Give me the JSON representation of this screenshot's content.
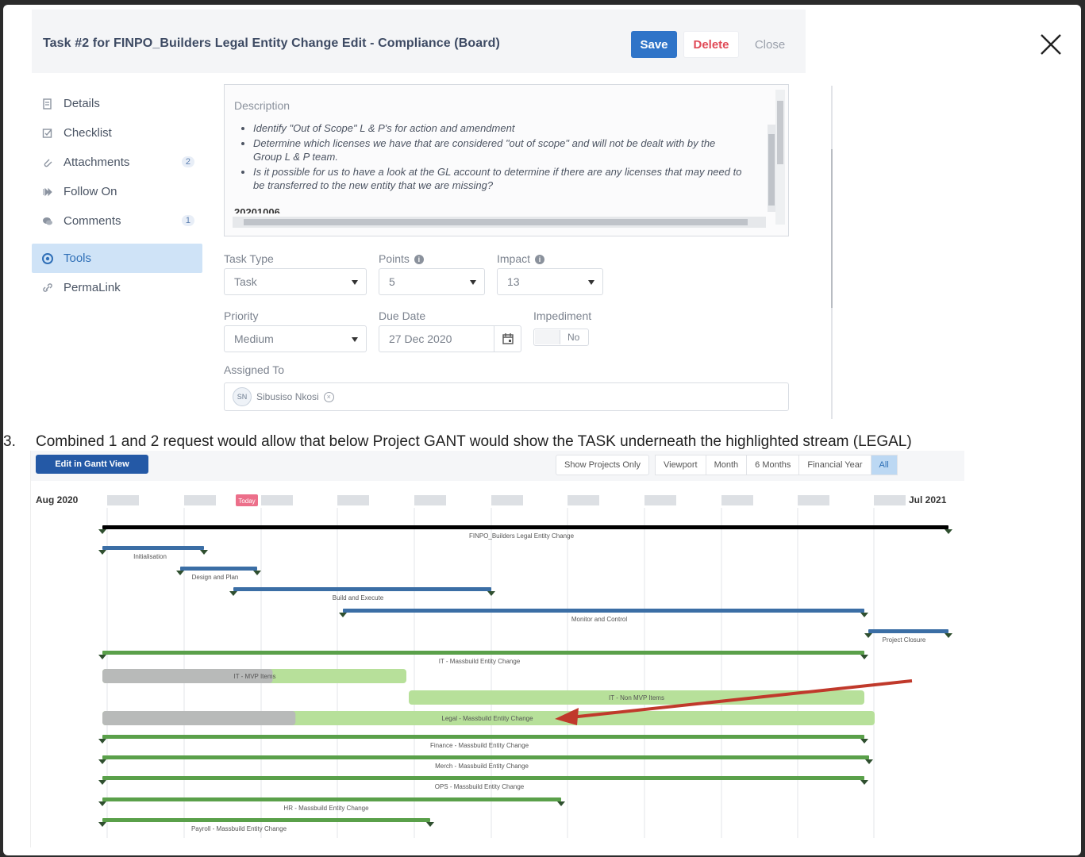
{
  "dialog": {
    "title": "Task #2 for FINPO_Builders Legal Entity Change Edit - Compliance (Board)",
    "save_label": "Save",
    "delete_label": "Delete",
    "close_label": "Close"
  },
  "sidebar": {
    "items": [
      {
        "label": "Details",
        "icon": "document-icon"
      },
      {
        "label": "Checklist",
        "icon": "checkbox-icon"
      },
      {
        "label": "Attachments",
        "icon": "paperclip-icon",
        "badge": "2"
      },
      {
        "label": "Follow On",
        "icon": "fast-forward-icon"
      },
      {
        "label": "Comments",
        "icon": "chat-icon",
        "badge": "1"
      },
      {
        "label": "Tools",
        "icon": "gear-icon",
        "active": true
      },
      {
        "label": "PermaLink",
        "icon": "link-icon"
      }
    ]
  },
  "description": {
    "label": "Description",
    "bullets": [
      "Identify \"Out of Scope\" L & P's for action and amendment",
      "Determine which licenses we have that are considered \"out of scope\" and will not be dealt with by the Group L & P team.",
      "Is it possible for us to have a look at the GL account to determine if there are any licenses that may need to be transferred to the new entity that we are missing?"
    ],
    "cut_off_text": "20201006"
  },
  "fields": {
    "task_type": {
      "label": "Task Type",
      "value": "Task"
    },
    "points": {
      "label": "Points",
      "value": "5"
    },
    "impact": {
      "label": "Impact",
      "value": "13"
    },
    "priority": {
      "label": "Priority",
      "value": "Medium"
    },
    "due_date": {
      "label": "Due Date",
      "value": "27 Dec 2020"
    },
    "impediment": {
      "label": "Impediment",
      "value": "No"
    },
    "assigned_to": {
      "label": "Assigned To",
      "initials": "SN",
      "name": "Sibusiso Nkosi"
    }
  },
  "instruction": {
    "number": "3.",
    "text": "Combined 1 and 2 request would allow that below Project GANT would show the TASK underneath the highlighted stream (LEGAL)"
  },
  "gantt": {
    "edit_button": "Edit in Gantt View",
    "view_tabs": [
      "Show Projects Only",
      "Viewport",
      "Month",
      "6 Months",
      "Financial Year",
      "All"
    ],
    "active_tab": "All",
    "start_label": "Aug 2020",
    "end_label": "Jul 2021",
    "today_label": "Today",
    "bars": [
      {
        "label": "FINPO_Builders Legal Entity Change",
        "kind": "project"
      },
      {
        "label": "Initialisation",
        "kind": "phase"
      },
      {
        "label": "Design and Plan",
        "kind": "phase"
      },
      {
        "label": "Build and Execute",
        "kind": "phase"
      },
      {
        "label": "Monitor and Control",
        "kind": "phase"
      },
      {
        "label": "Project Closure",
        "kind": "phase"
      },
      {
        "label": "IT - Massbuild Entity Change",
        "kind": "stream"
      },
      {
        "label": "IT - MVP Items",
        "kind": "task"
      },
      {
        "label": "IT - Non MVP Items",
        "kind": "task"
      },
      {
        "label": "Legal - Massbuild Entity Change",
        "kind": "task",
        "highlighted": true
      },
      {
        "label": "Finance - Massbuild Entity Change",
        "kind": "stream"
      },
      {
        "label": "Merch - Massbuild Entity Change",
        "kind": "stream"
      },
      {
        "label": "OPS - Massbuild Entity Change",
        "kind": "stream"
      },
      {
        "label": "HR - Massbuild Entity Change",
        "kind": "stream"
      },
      {
        "label": "Payroll - Massbuild Entity Change",
        "kind": "stream"
      }
    ],
    "colors": {
      "phase": "#3b6ea5",
      "stream": "#5aa04a",
      "task": "#b7e09a",
      "progress": "#b8bab9",
      "arrow": "#c0392b"
    }
  }
}
